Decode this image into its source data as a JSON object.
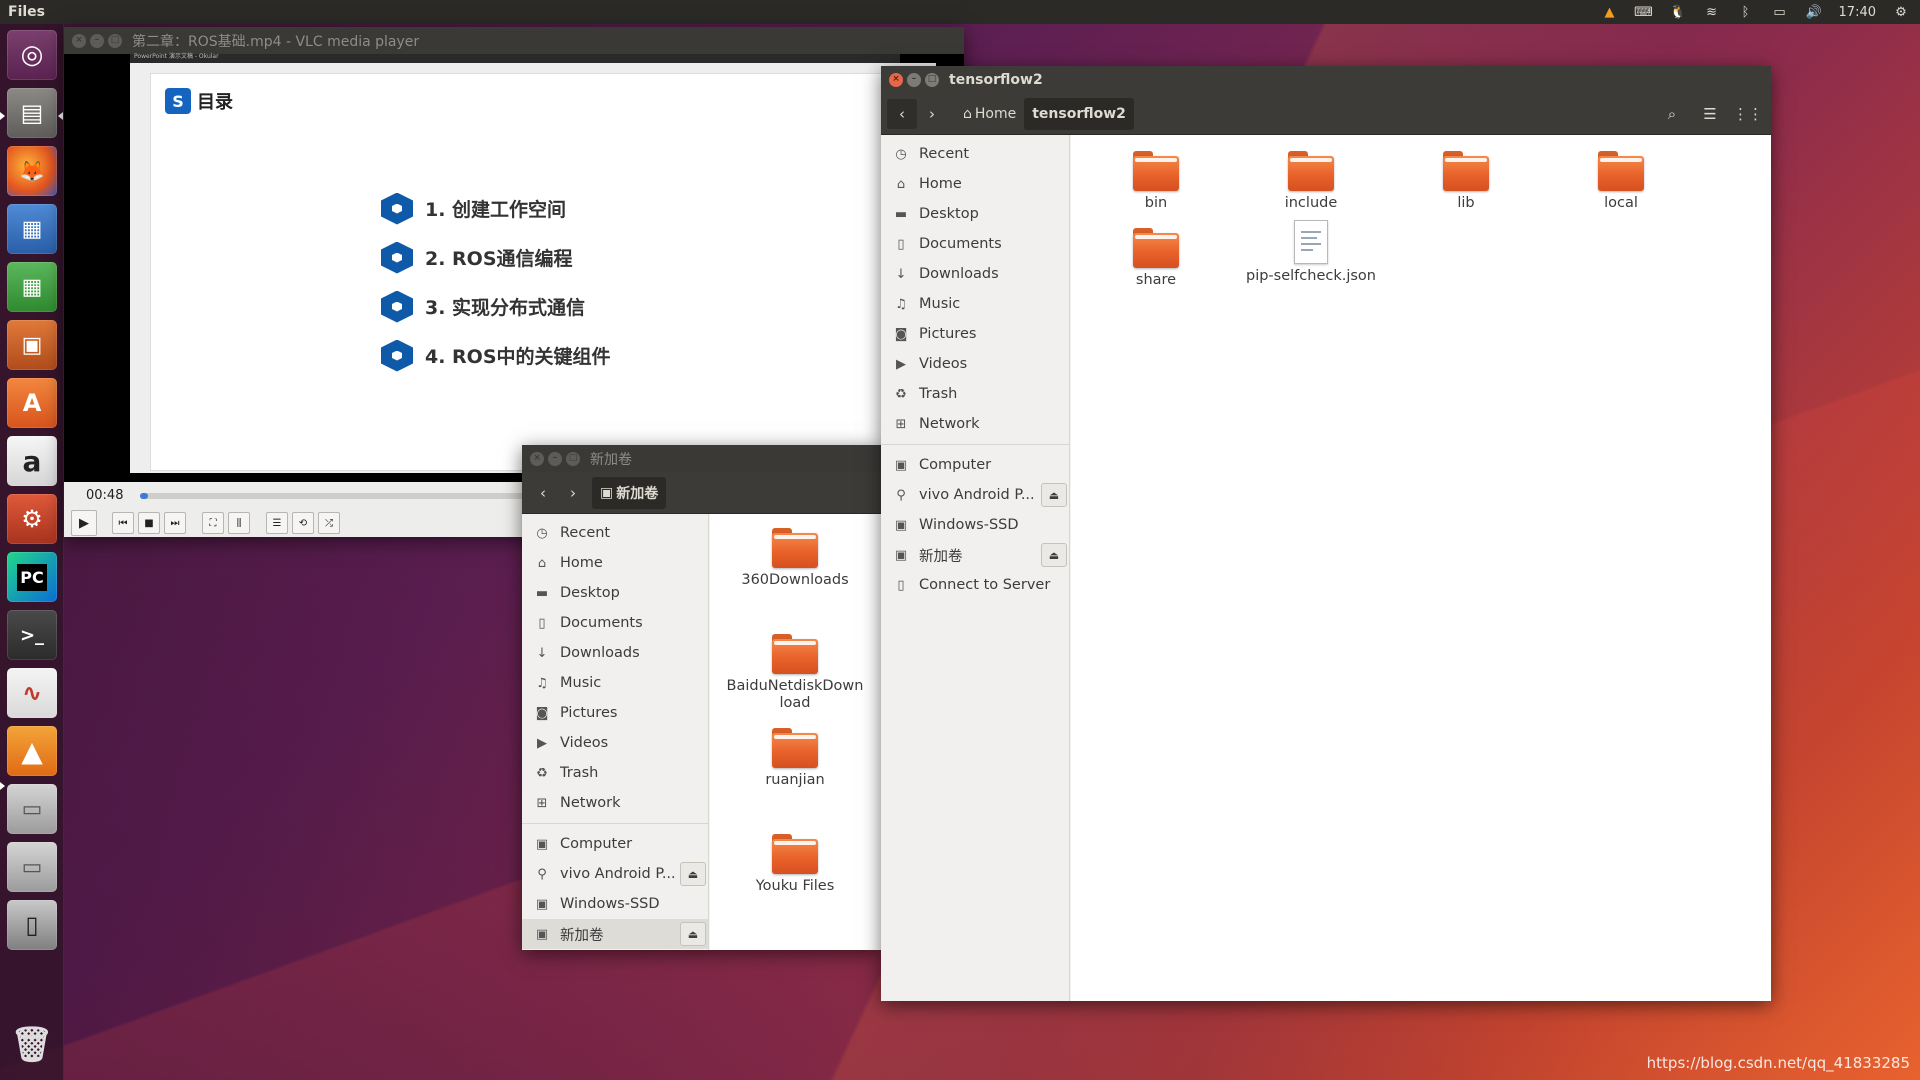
{
  "top_panel": {
    "app_name": "Files",
    "clock": "17:40"
  },
  "vlc": {
    "title": "第二章：ROS基础.mp4 - VLC media player",
    "embedded_bar": "PowerPoint 演示文稿 - Okular",
    "slide_heading": "目录",
    "slide_items": [
      "1. 创建工作空间",
      "2. ROS通信编程",
      "3. 实现分布式通信",
      "4. ROS中的关键组件"
    ],
    "time": "00:48",
    "progress": 0.01
  },
  "tf2": {
    "title": "tensorflow2",
    "crumbs": [
      "Home",
      "tensorflow2"
    ],
    "sidebar": [
      "Recent",
      "Home",
      "Desktop",
      "Documents",
      "Downloads",
      "Music",
      "Pictures",
      "Videos",
      "Trash",
      "Network"
    ],
    "devices": [
      "Computer",
      "vivo Android P...",
      "Windows-SSD",
      "新加卷",
      "Connect to Server"
    ],
    "files": [
      "bin",
      "include",
      "lib",
      "local",
      "share",
      "pip-selfcheck.json"
    ]
  },
  "xjj": {
    "title": "新加卷",
    "crumb": "新加卷",
    "sidebar": [
      "Recent",
      "Home",
      "Desktop",
      "Documents",
      "Downloads",
      "Music",
      "Pictures",
      "Videos",
      "Trash",
      "Network"
    ],
    "devices": [
      "Computer",
      "vivo Android P...",
      "Windows-SSD",
      "新加卷"
    ],
    "files": [
      "360Downloads",
      "BaiduNetdiskDownload",
      "ruanjian",
      "Youku Files"
    ]
  },
  "watermark": "https://blog.csdn.net/qq_41833285",
  "colors": {
    "accent_orange": "#e95420",
    "close_button": "#e7674a",
    "slide_blue": "#0f5aa8"
  }
}
